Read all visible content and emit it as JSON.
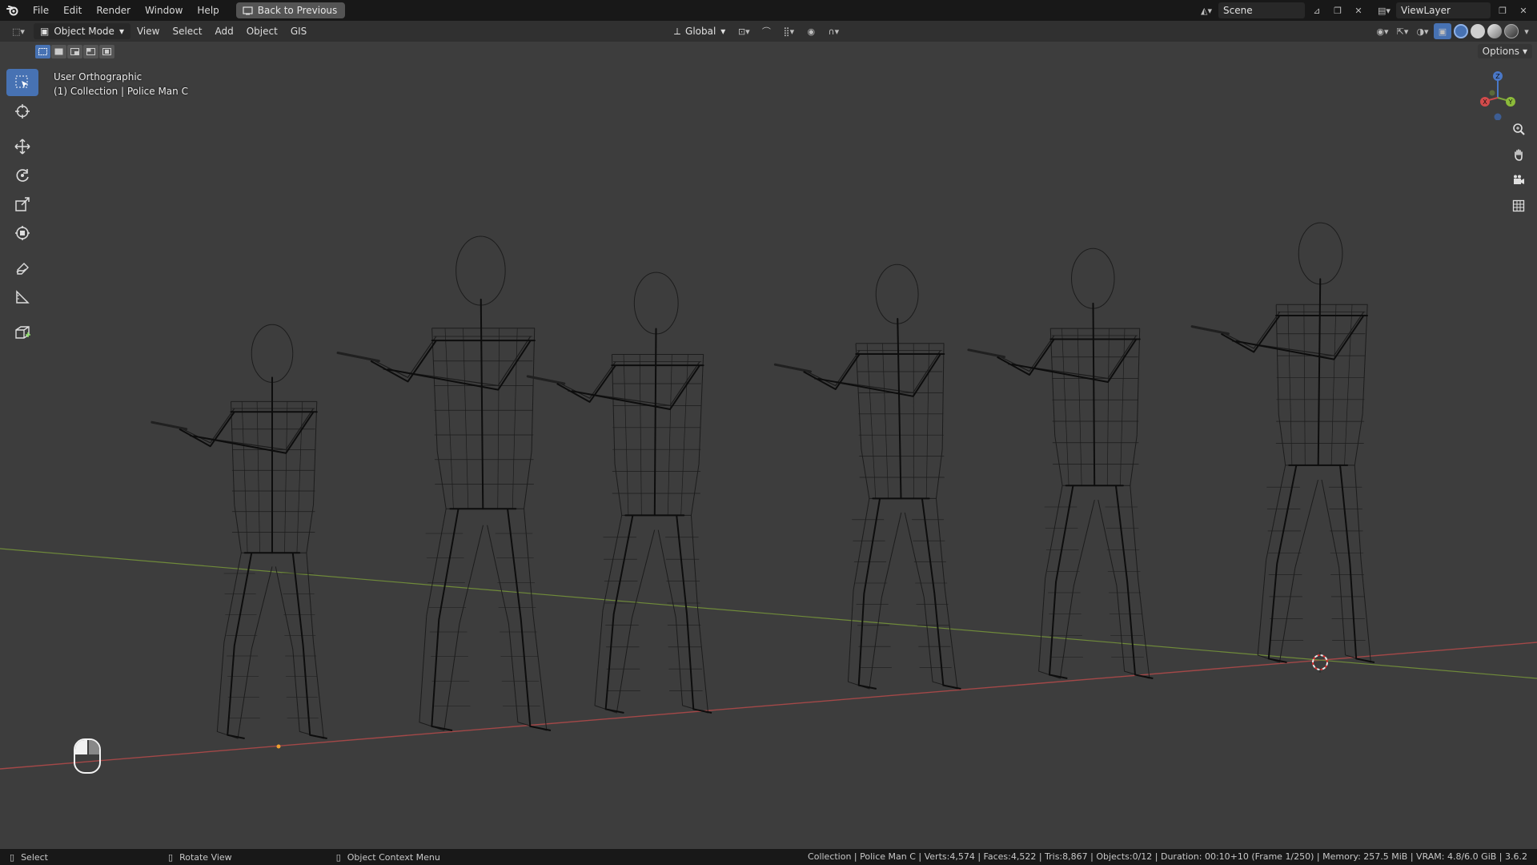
{
  "menu": {
    "file": "File",
    "edit": "Edit",
    "render": "Render",
    "window": "Window",
    "help": "Help",
    "back_button": "Back to Previous"
  },
  "top_right": {
    "scene": "Scene",
    "view_layer": "ViewLayer"
  },
  "header": {
    "mode": "Object Mode",
    "view": "View",
    "select": "Select",
    "add": "Add",
    "object": "Object",
    "gis": "GIS",
    "orientation": "Global",
    "options": "Options"
  },
  "viewport": {
    "view_name": "User Orthographic",
    "collection": "(1) Collection | Police Man C"
  },
  "statusbar": {
    "select": "Select",
    "rotate": "Rotate View",
    "context": "Object Context Menu",
    "stats": "Collection | Police Man C | Verts:4,574 | Faces:4,522 | Tris:8,867 | Objects:0/12 | Duration: 00:10+10 (Frame 1/250) | Memory: 257.5 MiB | VRAM: 4.8/6.0 GiB | 3.6.2"
  },
  "colors": {
    "viewport_bg": "#3d3d3d",
    "accent": "#4772b3",
    "x_axis": "#c0504d",
    "y_axis": "#7a9a3a",
    "wire": "#151515"
  }
}
